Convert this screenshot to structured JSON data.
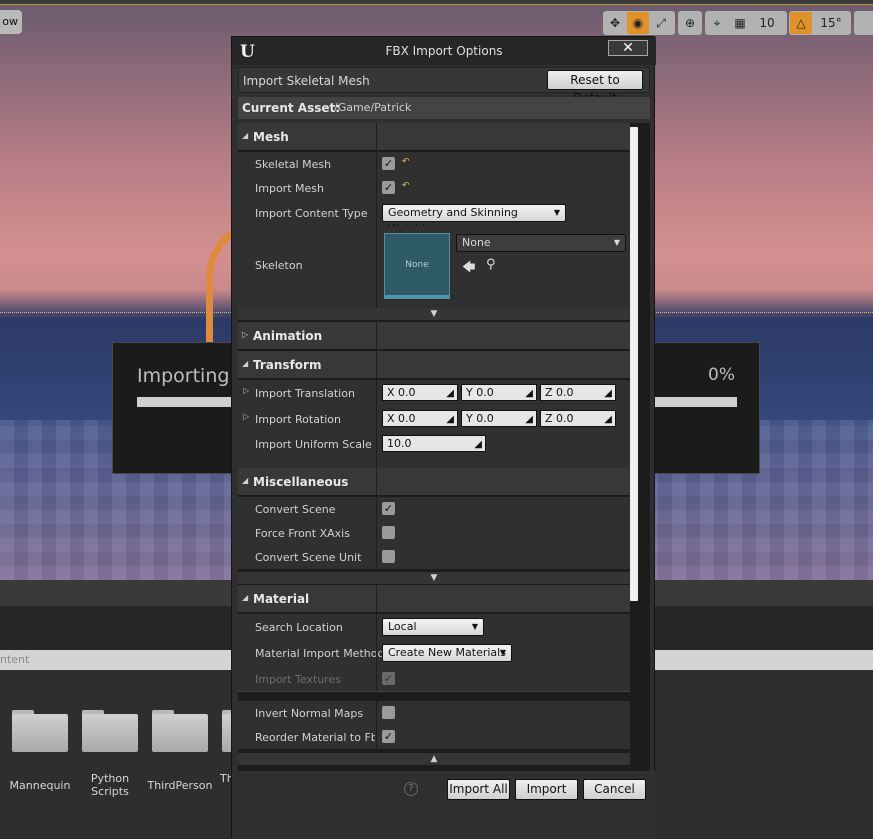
{
  "viewport": {
    "mode_button": "ow",
    "grid_snap": "10",
    "rotation_snap": "15°"
  },
  "progress": {
    "label": "Importing \"F",
    "percent_text": "0%",
    "percent": 0
  },
  "content_browser": {
    "filter_placeholder": "ntent",
    "folders": [
      {
        "label": "Mannequin"
      },
      {
        "label": "Python Scripts"
      },
      {
        "label": "ThirdPerson"
      },
      {
        "label": "Th"
      }
    ]
  },
  "dialog": {
    "title": "FBX Import Options",
    "close_glyph": "✕",
    "header": "Import Skeletal Mesh",
    "reset_button": "Reset to Default",
    "current_asset_label": "Current Asset:",
    "current_asset_value": "/Game/Patrick",
    "sections": {
      "mesh": {
        "label": "Mesh",
        "skeletal_mesh": {
          "label": "Skeletal Mesh",
          "checked": true
        },
        "import_mesh": {
          "label": "Import Mesh",
          "checked": true
        },
        "import_content_type": {
          "label": "Import Content Type",
          "value": "Geometry and Skinning Weights."
        },
        "skeleton": {
          "label": "Skeleton",
          "thumb_text": "None",
          "value": "None"
        }
      },
      "animation": {
        "label": "Animation"
      },
      "transform": {
        "label": "Transform",
        "import_translation": {
          "label": "Import Translation",
          "x": "X  0.0",
          "y": "Y  0.0",
          "z": "Z  0.0"
        },
        "import_rotation": {
          "label": "Import Rotation",
          "x": "X  0.0",
          "y": "Y  0.0",
          "z": "Z  0.0"
        },
        "import_uniform_scale": {
          "label": "Import Uniform Scale",
          "value": "10.0"
        }
      },
      "misc": {
        "label": "Miscellaneous",
        "convert_scene": {
          "label": "Convert Scene",
          "checked": true
        },
        "force_front_xaxis": {
          "label": "Force Front XAxis",
          "checked": false
        },
        "convert_scene_unit": {
          "label": "Convert Scene Unit",
          "checked": false
        }
      },
      "material": {
        "label": "Material",
        "search_location": {
          "label": "Search Location",
          "value": "Local"
        },
        "material_import_method": {
          "label": "Material Import Method",
          "value": "Create New Materials"
        },
        "import_textures": {
          "label": "Import Textures",
          "checked": true
        },
        "invert_normal_maps": {
          "label": "Invert Normal Maps",
          "checked": false
        },
        "reorder_material": {
          "label": "Reorder Material to Fbx",
          "checked": true
        }
      }
    },
    "buttons": {
      "import_all": "Import All",
      "import": "Import",
      "cancel": "Cancel",
      "help": "?"
    }
  }
}
